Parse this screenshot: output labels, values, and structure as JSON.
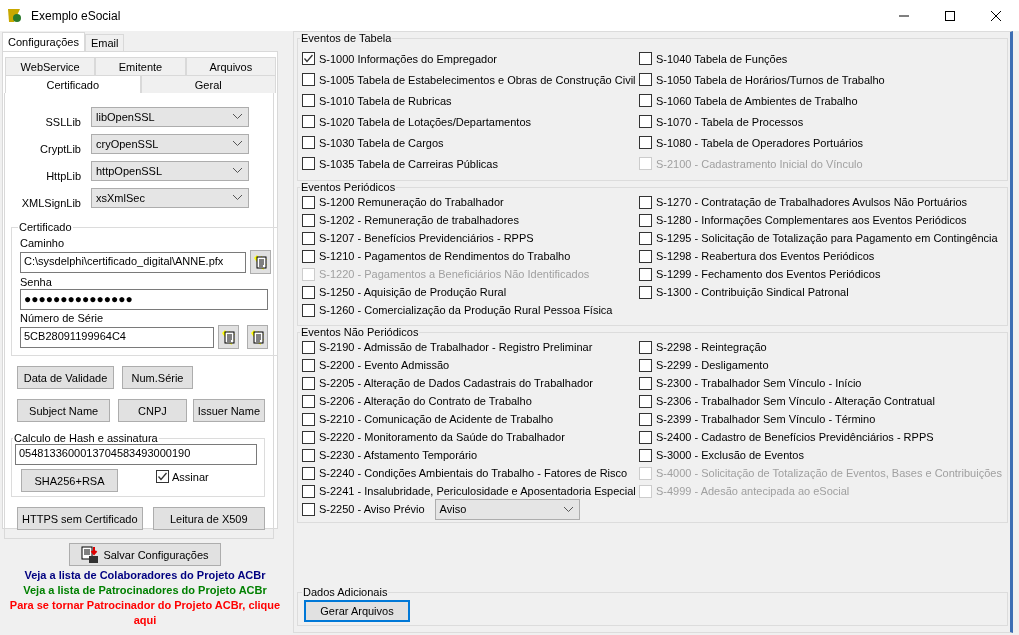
{
  "window": {
    "title": "Exemplo eSocial"
  },
  "tabs": [
    {
      "label": "Configurações",
      "selected": true
    },
    {
      "label": "Email",
      "selected": false
    }
  ],
  "subtabs": [
    [
      {
        "label": "WebService",
        "selected": false
      },
      {
        "label": "Emitente",
        "selected": false
      },
      {
        "label": "Arquivos",
        "selected": false
      }
    ],
    [
      {
        "label": "Certificado",
        "selected": true
      },
      {
        "label": "Geral",
        "selected": false
      }
    ]
  ],
  "libs": [
    {
      "label": "SSLLib",
      "value": "libOpenSSL"
    },
    {
      "label": "CryptLib",
      "value": "cryOpenSSL"
    },
    {
      "label": "HttpLib",
      "value": "httpOpenSSL"
    },
    {
      "label": "XMLSignLib",
      "value": "xsXmlSec"
    }
  ],
  "certificado": {
    "title": "Certificado",
    "caminho_label": "Caminho",
    "caminho": "C:\\sysdelphi\\certificado_digital\\ANNE.pfx",
    "senha_label": "Senha",
    "senha": "●●●●●●●●●●●●●●●",
    "serie_label": "Número de Série",
    "serie": "5CB28091199964C4"
  },
  "cert_buttons": [
    [
      "Data de Validade",
      "Num.Série"
    ],
    [
      "Subject Name",
      "CNPJ",
      "Issuer Name"
    ]
  ],
  "hash": {
    "title": "Calculo de Hash e assinatura",
    "value": "0548133600013704583493000190",
    "button": "SHA256+RSA",
    "assinar": {
      "label": "Assinar",
      "checked": true
    }
  },
  "bottom_buttons": [
    "HTTPS sem Certificado",
    "Leitura de X509"
  ],
  "save_button": "Salvar Configurações",
  "links": [
    {
      "text": "Veja a lista de Colaboradores do Projeto ACBr",
      "color": "#000080"
    },
    {
      "text": "Veja a lista de Patrocinadores do Projeto ACBr",
      "color": "#008000"
    },
    {
      "text": "Para se tornar Patrocinador do Projeto ACBr, clique aqui",
      "color": "#ff0000"
    }
  ],
  "groups": [
    {
      "title": "Eventos de Tabela",
      "left": [
        {
          "kind": "checkbox",
          "label": "S-1000 Informações do Empregador",
          "checked": true,
          "disabled": false
        },
        {
          "kind": "checkbox",
          "label": "S-1005 Tabela de Estabelecimentos e Obras de Construção Civil",
          "checked": false,
          "disabled": false
        },
        {
          "kind": "checkbox",
          "label": "S-1010 Tabela de Rubricas",
          "checked": false,
          "disabled": false
        },
        {
          "kind": "checkbox",
          "label": "S-1020 Tabela de Lotações/Departamentos",
          "checked": false,
          "disabled": false
        },
        {
          "kind": "checkbox",
          "label": "S-1030 Tabela de Cargos",
          "checked": false,
          "disabled": false
        },
        {
          "kind": "checkbox",
          "label": "S-1035 Tabela de Carreiras Públicas",
          "checked": false,
          "disabled": false
        }
      ],
      "right": [
        {
          "kind": "checkbox",
          "label": "S-1040 Tabela de Funções",
          "checked": false,
          "disabled": false
        },
        {
          "kind": "checkbox",
          "label": "S-1050 Tabela de Horários/Turnos de Trabalho",
          "checked": false,
          "disabled": false
        },
        {
          "kind": "checkbox",
          "label": "S-1060 Tabela de Ambientes de Trabalho",
          "checked": false,
          "disabled": false
        },
        {
          "kind": "checkbox",
          "label": "S-1070 - Tabela de Processos",
          "checked": false,
          "disabled": false
        },
        {
          "kind": "checkbox",
          "label": "S-1080 - Tabela de Operadores Portuários",
          "checked": false,
          "disabled": false
        },
        {
          "kind": "checkbox",
          "label": "S-2100 - Cadastramento Inicial do Vínculo",
          "checked": false,
          "disabled": true
        }
      ]
    },
    {
      "title": "Eventos Periódicos",
      "left": [
        {
          "kind": "checkbox",
          "label": "S-1200 Remuneração do Trabalhador",
          "checked": false,
          "disabled": false
        },
        {
          "kind": "checkbox",
          "label": "S-1202 - Remuneração de trabalhadores",
          "checked": false,
          "disabled": false
        },
        {
          "kind": "checkbox",
          "label": "S-1207 - Benefícios  Previdenciários - RPPS",
          "checked": false,
          "disabled": false
        },
        {
          "kind": "checkbox",
          "label": "S-1210 - Pagamentos de Rendimentos do Trabalho",
          "checked": false,
          "disabled": false
        },
        {
          "kind": "checkbox",
          "label": "S-1220 - Pagamentos a Beneficiários Não Identificados",
          "checked": false,
          "disabled": true
        },
        {
          "kind": "checkbox",
          "label": "S-1250 - Aquisição de Produção Rural",
          "checked": false,
          "disabled": false
        },
        {
          "kind": "checkbox",
          "label": "S-1260 - Comercialização da Produção Rural Pessoa Física",
          "checked": false,
          "disabled": false
        }
      ],
      "right": [
        {
          "kind": "checkbox",
          "label": "S-1270 - Contratação de Trabalhadores Avulsos Não Portuários",
          "checked": false,
          "disabled": false
        },
        {
          "kind": "checkbox",
          "label": "S-1280 - Informações Complementares aos Eventos Periódicos",
          "checked": false,
          "disabled": false
        },
        {
          "kind": "checkbox",
          "label": "S-1295 - Solicitação de Totalização para Pagamento em Contingência",
          "checked": false,
          "disabled": false
        },
        {
          "kind": "checkbox",
          "label": "S-1298 - Reabertura dos Eventos Periódicos",
          "checked": false,
          "disabled": false
        },
        {
          "kind": "checkbox",
          "label": "S-1299 - Fechamento dos Eventos Periódicos",
          "checked": false,
          "disabled": false
        },
        {
          "kind": "checkbox",
          "label": "S-1300 - Contribuição Sindical Patronal",
          "checked": false,
          "disabled": false
        }
      ]
    },
    {
      "title": "Eventos Não Periódicos",
      "left": [
        {
          "kind": "checkbox",
          "label": "S-2190 - Admissão de Trabalhador - Registro Preliminar",
          "checked": false,
          "disabled": false
        },
        {
          "kind": "checkbox",
          "label": "S-2200 -  Evento Admissão",
          "checked": false,
          "disabled": false
        },
        {
          "kind": "checkbox",
          "label": "S-2205 - Alteração de Dados Cadastrais do Trabalhador",
          "checked": false,
          "disabled": false
        },
        {
          "kind": "checkbox",
          "label": "S-2206 - Alteração do Contrato de Trabalho",
          "checked": false,
          "disabled": false
        },
        {
          "kind": "checkbox",
          "label": "S-2210 - Comunicação de Acidente de Trabalho",
          "checked": false,
          "disabled": false
        },
        {
          "kind": "checkbox",
          "label": "S-2220 -  Monitoramento da Saúde do Trabalhador",
          "checked": false,
          "disabled": false
        },
        {
          "kind": "checkbox",
          "label": "S-2230 - Afstamento Temporário",
          "checked": false,
          "disabled": false
        },
        {
          "kind": "checkbox",
          "label": "S-2240 -  Condições Ambientais do Trabalho - Fatores de Risco",
          "checked": false,
          "disabled": false
        },
        {
          "kind": "checkbox",
          "label": "S-2241 - Insalubridade, Periculosidade e Aposentadoria Especial",
          "checked": false,
          "disabled": false
        },
        {
          "kind": "select",
          "label": "S-2250 - Aviso Prévio",
          "checked": false,
          "disabled": false,
          "value": "Aviso"
        }
      ],
      "right": [
        {
          "kind": "checkbox",
          "label": "S-2298 - Reintegração",
          "checked": false,
          "disabled": false
        },
        {
          "kind": "checkbox",
          "label": "S-2299 - Desligamento",
          "checked": false,
          "disabled": false
        },
        {
          "kind": "checkbox",
          "label": "S-2300 - Trabalhador Sem Vínculo - Início",
          "checked": false,
          "disabled": false
        },
        {
          "kind": "checkbox",
          "label": "S-2306 - Trabalhador Sem Vínculo - Alteração Contratual",
          "checked": false,
          "disabled": false
        },
        {
          "kind": "checkbox",
          "label": "S-2399 - Trabalhador Sem Vínculo - Término",
          "checked": false,
          "disabled": false
        },
        {
          "kind": "checkbox",
          "label": "S-2400 - Cadastro de Benefícios Previdênciários - RPPS",
          "checked": false,
          "disabled": false
        },
        {
          "kind": "checkbox",
          "label": "S-3000 - Exclusão de Eventos",
          "checked": false,
          "disabled": false
        },
        {
          "kind": "checkbox",
          "label": "S-4000 - Solicitação de Totalização de Eventos, Bases e Contribuições",
          "checked": false,
          "disabled": true
        },
        {
          "kind": "checkbox",
          "label": "S-4999 - Adesão antecipada ao eSocial",
          "checked": false,
          "disabled": true
        }
      ]
    }
  ],
  "dados": {
    "title": "Dados Adicionais",
    "button": "Gerar Arquivos"
  }
}
